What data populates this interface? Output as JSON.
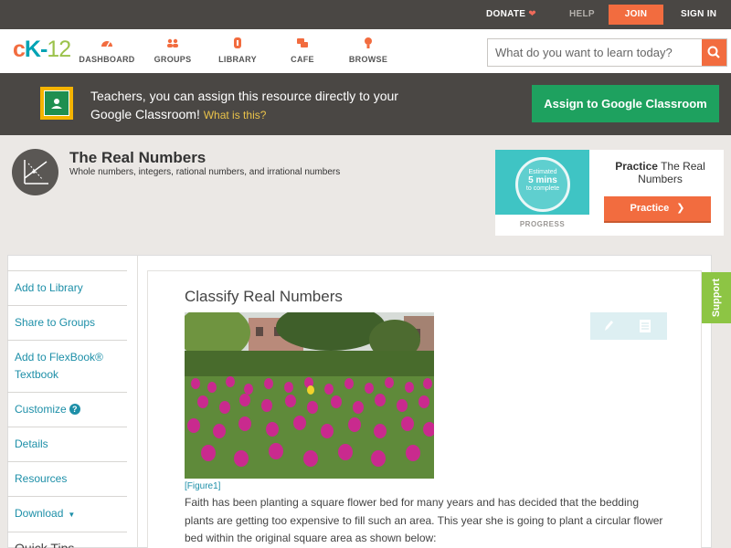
{
  "topbar": {
    "donate": "DONATE",
    "help": "HELP",
    "join": "JOIN",
    "sign_in": "SIGN IN"
  },
  "nav": {
    "logo": {
      "c": "c",
      "k": "K-",
      "num": "12"
    },
    "items": [
      {
        "label": "DASHBOARD",
        "icon": "dashboard-icon"
      },
      {
        "label": "GROUPS",
        "icon": "groups-icon"
      },
      {
        "label": "LIBRARY",
        "icon": "library-icon"
      },
      {
        "label": "CAFE",
        "icon": "cafe-icon"
      },
      {
        "label": "BROWSE",
        "icon": "browse-icon"
      }
    ],
    "search_placeholder": "What do you want to learn today?"
  },
  "classroom_banner": {
    "message": "Teachers, you can assign this resource directly to your Google Classroom!",
    "what_link": "What is this?",
    "button": "Assign to Google Classroom"
  },
  "concept": {
    "title": "The Real Numbers",
    "subtitle": "Whole numbers, integers, rational numbers, and irrational numbers"
  },
  "practice": {
    "estimated": "Estimated",
    "mins": "5 mins",
    "to_complete": "to complete",
    "progress_label": "PROGRESS",
    "title_bold": "Practice",
    "title_rest": "The Real Numbers",
    "button": "Practice"
  },
  "sidebar": {
    "items": [
      {
        "label": "Add to Library"
      },
      {
        "label": "Share to Groups"
      },
      {
        "label": "Add to FlexBook® Textbook"
      },
      {
        "label": "Customize"
      },
      {
        "label": "Details"
      },
      {
        "label": "Resources"
      },
      {
        "label": "Download"
      }
    ],
    "quick_tips": "Quick Tips"
  },
  "article": {
    "title": "Classify Real Numbers",
    "figure_label": "[Figure1]",
    "body": "Faith has been planting a square flower bed for many years and has decided that the bedding plants are getting too expensive to fill such an area. This year she is going to plant a circular flower bed within the original square area as shown below:"
  },
  "support_tab": "Support",
  "colors": {
    "accent_orange": "#f26c3f",
    "link_teal": "#1d8fa8",
    "classroom_green": "#1ea15f",
    "support_green": "#8dc544",
    "dark_bar": "#4a4744"
  }
}
